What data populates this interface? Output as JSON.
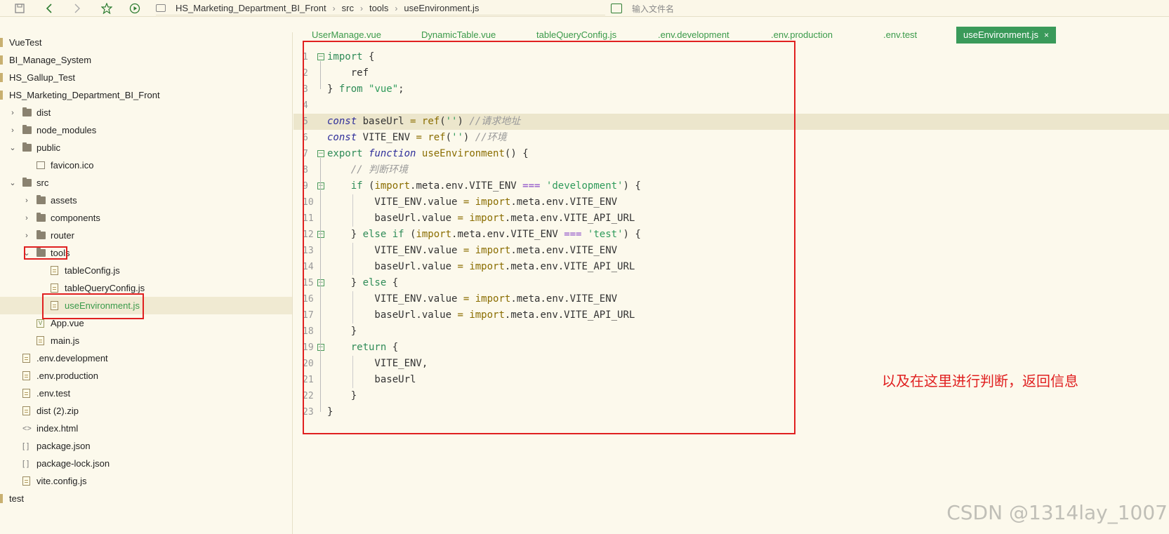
{
  "toolbar": {
    "icons": [
      "save-icon",
      "back-icon",
      "forward-icon",
      "star-icon",
      "run-icon"
    ],
    "breadcrumb": [
      "HS_Marketing_Department_BI_Front",
      "src",
      "tools",
      "useEnvironment.js"
    ],
    "search_placeholder": "输入文件名"
  },
  "sidebar": {
    "items": [
      {
        "label": "VueTest",
        "type": "project",
        "depth": 0
      },
      {
        "label": "BI_Manage_System",
        "type": "project",
        "depth": 0
      },
      {
        "label": "HS_Gallup_Test",
        "type": "project",
        "depth": 0
      },
      {
        "label": "HS_Marketing_Department_BI_Front",
        "type": "project",
        "depth": 0
      },
      {
        "label": "dist",
        "type": "folder",
        "depth": 1,
        "chevron": "›"
      },
      {
        "label": "node_modules",
        "type": "folder",
        "depth": 1,
        "chevron": "›"
      },
      {
        "label": "public",
        "type": "folder",
        "depth": 1,
        "chevron": "⌄"
      },
      {
        "label": "favicon.ico",
        "type": "image",
        "depth": 2
      },
      {
        "label": "src",
        "type": "folder",
        "depth": 1,
        "chevron": "⌄"
      },
      {
        "label": "assets",
        "type": "folder",
        "depth": 2,
        "chevron": "›"
      },
      {
        "label": "components",
        "type": "folder",
        "depth": 2,
        "chevron": "›"
      },
      {
        "label": "router",
        "type": "folder",
        "depth": 2,
        "chevron": "›"
      },
      {
        "label": "tools",
        "type": "folder",
        "depth": 2,
        "chevron": "⌄"
      },
      {
        "label": "tableConfig.js",
        "type": "file",
        "depth": 3
      },
      {
        "label": "tableQueryConfig.js",
        "type": "file",
        "depth": 3
      },
      {
        "label": "useEnvironment.js",
        "type": "file",
        "depth": 3,
        "selected": true
      },
      {
        "label": "App.vue",
        "type": "vue",
        "depth": 2
      },
      {
        "label": "main.js",
        "type": "file",
        "depth": 2
      },
      {
        "label": ".env.development",
        "type": "file",
        "depth": 1
      },
      {
        "label": ".env.production",
        "type": "file",
        "depth": 1
      },
      {
        "label": ".env.test",
        "type": "file",
        "depth": 1
      },
      {
        "label": "dist (2).zip",
        "type": "file",
        "depth": 1
      },
      {
        "label": "index.html",
        "type": "html",
        "depth": 1
      },
      {
        "label": "package.json",
        "type": "json",
        "depth": 1
      },
      {
        "label": "package-lock.json",
        "type": "json",
        "depth": 1
      },
      {
        "label": "vite.config.js",
        "type": "file",
        "depth": 1
      },
      {
        "label": "test",
        "type": "project",
        "depth": 0
      }
    ]
  },
  "tabs": [
    {
      "label": "UserManage.vue"
    },
    {
      "label": "DynamicTable.vue"
    },
    {
      "label": "tableQueryConfig.js"
    },
    {
      "label": ".env.development"
    },
    {
      "label": ".env.production"
    },
    {
      "label": ".env.test"
    },
    {
      "label": "useEnvironment.js",
      "active": true,
      "close": "×"
    }
  ],
  "code_lines": [
    {
      "n": "1",
      "fold": "−",
      "html": "<span class='kw'>import</span> {"
    },
    {
      "n": "2",
      "html": "    ref"
    },
    {
      "n": "3",
      "html": "} <span class='kw'>from</span> <span class='str'>\"vue\"</span>;"
    },
    {
      "n": "4",
      "html": ""
    },
    {
      "n": "5",
      "html": "<span class='kwi'>const</span> baseUrl <span class='fn'>=</span> <span class='fn'>ref</span>(<span class='str'>''</span>) <span class='cm'>//请求地址</span>",
      "current": true
    },
    {
      "n": "6",
      "html": "<span class='kwi'>const</span> VITE_ENV <span class='fn'>=</span> <span class='fn'>ref</span>(<span class='str'>''</span>) <span class='cm'>//环境</span>"
    },
    {
      "n": "7",
      "fold": "−",
      "html": "<span class='kw'>export</span> <span class='kwi'>function</span> <span class='fn'>useEnvironment</span>() {"
    },
    {
      "n": "8",
      "html": "    <span class='cm'>// 判断环境</span>"
    },
    {
      "n": "9",
      "fold": "−",
      "html": "    <span class='kw'>if</span> (<span class='fn'>import</span>.meta.env.VITE_ENV <span class='op'>===</span> <span class='str'>'development'</span>) {"
    },
    {
      "n": "10",
      "html": "        VITE_ENV.value <span class='fn'>=</span> <span class='fn'>import</span>.meta.env.VITE_ENV"
    },
    {
      "n": "11",
      "html": "        baseUrl.value <span class='fn'>=</span> <span class='fn'>import</span>.meta.env.VITE_API_URL"
    },
    {
      "n": "12",
      "fold": "−",
      "html": "    } <span class='kw'>else</span> <span class='kw'>if</span> (<span class='fn'>import</span>.meta.env.VITE_ENV <span class='op'>===</span> <span class='str'>'test'</span>) {"
    },
    {
      "n": "13",
      "html": "        VITE_ENV.value <span class='fn'>=</span> <span class='fn'>import</span>.meta.env.VITE_ENV"
    },
    {
      "n": "14",
      "html": "        baseUrl.value <span class='fn'>=</span> <span class='fn'>import</span>.meta.env.VITE_API_URL"
    },
    {
      "n": "15",
      "fold": "−",
      "html": "    } <span class='kw'>else</span> {"
    },
    {
      "n": "16",
      "html": "        VITE_ENV.value <span class='fn'>=</span> <span class='fn'>import</span>.meta.env.VITE_ENV"
    },
    {
      "n": "17",
      "html": "        baseUrl.value <span class='fn'>=</span> <span class='fn'>import</span>.meta.env.VITE_API_URL"
    },
    {
      "n": "18",
      "html": "    }"
    },
    {
      "n": "19",
      "fold": "−",
      "html": "    <span class='kw'>return</span> {"
    },
    {
      "n": "20",
      "html": "        VITE_ENV,"
    },
    {
      "n": "21",
      "html": "        baseUrl"
    },
    {
      "n": "22",
      "html": "    }"
    },
    {
      "n": "23",
      "html": "}"
    }
  ],
  "annotation": "以及在这里进行判断，返回信息",
  "credit": "CSDN @1314lay_1007",
  "colors": {
    "highlight_red": "#e02020",
    "accent_green": "#3a9a5a",
    "background": "#fcf9ec"
  }
}
